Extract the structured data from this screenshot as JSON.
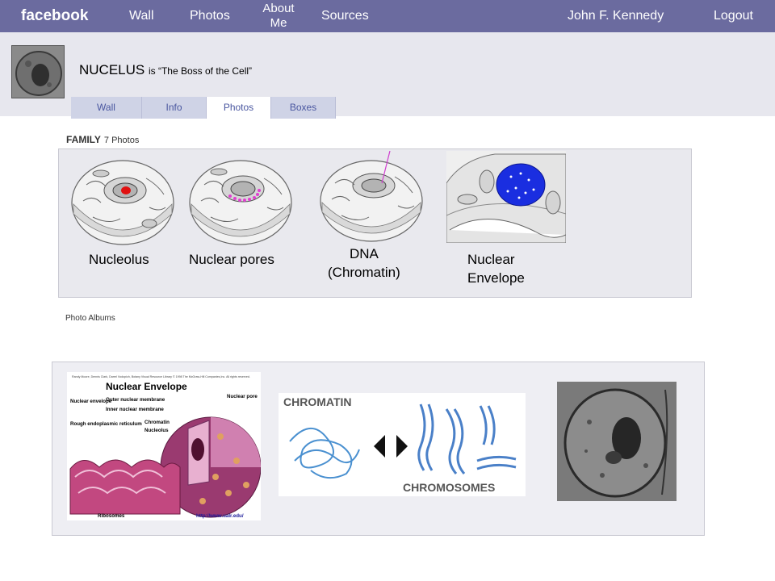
{
  "topbar": {
    "brand": "facebook",
    "nav": [
      "Wall",
      "Photos",
      "About Me",
      "Sources"
    ],
    "user": "John F. Kennedy",
    "logout": "Logout"
  },
  "profile": {
    "name": "NUCELUS",
    "tagline": "is “The Boss of the Cell”",
    "tabs": [
      "Wall",
      "Info",
      "Photos",
      "Boxes"
    ],
    "active_tab": "Photos"
  },
  "family": {
    "label": "FAMILY",
    "count": "7 Photos",
    "captions": [
      "Nucleolus",
      "Nuclear pores",
      "DNA",
      "(Chromatin)",
      "Nuclear",
      "Envelope"
    ]
  },
  "albums": {
    "label": "Photo Albums",
    "diagram1": {
      "credit": "Randy Moore, Dennis Clark, Darrel Vodopich, Botany Visual Resource Library © 1998 The McGraw-Hill Companies,Inc. All rights reserved.",
      "title": "Nuclear Envelope",
      "labels": [
        "Nuclear envelope",
        "Outer nuclear membrane",
        "Inner nuclear membrane",
        "Nuclear pore",
        "Rough endoplasmic reticulum",
        "Chromatin",
        "Nucleolus",
        "Ribosomes"
      ],
      "url": "http://www.ualr.edu/"
    },
    "diagram2": {
      "top": "CHROMATIN",
      "bottom": "CHROMOSOMES"
    }
  },
  "colors": {
    "topbar": "#6b6b9f",
    "header_bg": "#e7e7ee",
    "tab_bg": "#cfd3e6",
    "link": "#4a57a0",
    "nucleolus_marker": "#e01010",
    "pores_marker": "#e040d0",
    "envelope_nucleus": "#1a2ee0"
  }
}
